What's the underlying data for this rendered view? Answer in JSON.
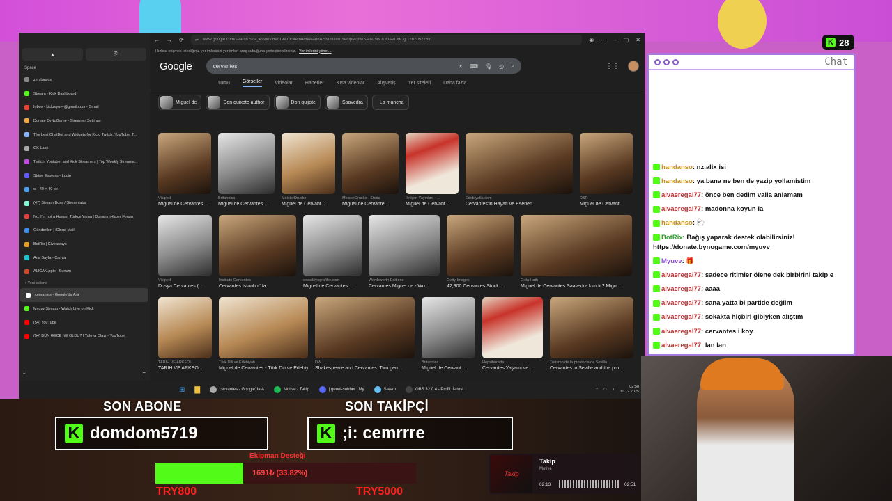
{
  "browser": {
    "url": "www.google.com/search?sca_esv=dc6ec19e7dc4ebae8easef=AE3TdOmrGAlupMqnwSAlNzsBUDOAVDHOg:1767052235",
    "info_text": "Hızlıca erişmek istediğiniz yer imlerinizi yer imleri araç çubuğuna yerleştirebilirsiniz.",
    "info_link": "Yer imlerini yönet...",
    "sidebar": {
      "space_label": "Space",
      "items": [
        {
          "label": "zen basics",
          "color": "#888"
        },
        {
          "label": "Stream - Kick Dashboard",
          "color": "#53fc18"
        },
        {
          "label": "Inbox - kickmyuvv@gmail.com - Gmail",
          "color": "#ea4335"
        },
        {
          "label": "Donate ByNoGame - Streamer Settings",
          "color": "#f4a742"
        },
        {
          "label": "The best ChatBot and Widgets for Kick, Twitch, YouTube, T...",
          "color": "#8ab4f8"
        },
        {
          "label": "GK Labs",
          "color": "#aaa"
        },
        {
          "label": "Twitch, Youtube, and Kick Streamers | Top Weekly Streame...",
          "color": "#c04ae0"
        },
        {
          "label": "Stripe Express - Login",
          "color": "#635bff"
        },
        {
          "label": "w - 40 × 40 px",
          "color": "#4aa0f0"
        },
        {
          "label": "(47) Stream Boss / Streamlabs",
          "color": "#80f5d2"
        },
        {
          "label": "No, I'm not a Human Türkçe Yama | DonanımHaber Forum",
          "color": "#e04040"
        },
        {
          "label": "Gönderilen | iCloud Mail",
          "color": "#3b8ef0"
        },
        {
          "label": "BotRix | Giveaways",
          "color": "#e8a020"
        },
        {
          "label": "Ana Sayfa - Canva",
          "color": "#20c4cc"
        },
        {
          "label": "ALICAN.pptx - Sunum",
          "color": "#d04a2a"
        }
      ],
      "new_tab": "Yeni sekme",
      "open_tabs": [
        {
          "label": "cervantes - Google'da Ara",
          "color": "#fff"
        },
        {
          "label": "Myuvv Stream - Watch Live on Kick",
          "color": "#53fc18"
        },
        {
          "label": "(54) YouTube",
          "color": "#ff0000"
        },
        {
          "label": "(54) DÜN GECE NE OLDU? | Yalova Olayı - YouTube",
          "color": "#ff0000"
        }
      ]
    },
    "google": {
      "logo": "Google",
      "query": "cervantes",
      "tabs": [
        "Tümü",
        "Görseller",
        "Videolar",
        "Haberler",
        "Kısa videolar",
        "Alışveriş",
        "Yer siteleri",
        "Daha fazla"
      ],
      "active_tab": "Görseller",
      "chips": [
        "Miguel de",
        "Don quixote author",
        "Don quijote",
        "Saavedra",
        "La mancha"
      ],
      "rows": [
        [
          {
            "src": "Vikipedi",
            "title": "Miguel de Cervantes ...",
            "w": 76,
            "tone": ""
          },
          {
            "src": "Britannica",
            "title": "Miguel de Cervantes ...",
            "w": 81,
            "tone": "bw"
          },
          {
            "src": "MeisterDrucke",
            "title": "Miguel de Cervant...",
            "w": 77,
            "tone": "lt"
          },
          {
            "src": "MeisterDrucke - Stoäa",
            "title": "Miguel de Cervante...",
            "w": 81,
            "tone": ""
          },
          {
            "src": "İletişim Yayınları · ...",
            "title": "Miguel de Cervant...",
            "w": 76,
            "tone": "rd"
          },
          {
            "src": "Edebiyatla.com",
            "title": "Cervantes'in Hayatı ve Eserleri",
            "w": 154,
            "tone": ""
          },
          {
            "src": "D&R",
            "title": "Miguel de Cervant...",
            "w": 76,
            "tone": ""
          }
        ],
        [
          {
            "src": "Vikipedi",
            "title": "Dosya:Cervantes (...",
            "w": 77,
            "tone": "bw"
          },
          {
            "src": "Instituto Cervantes",
            "title": "Cervantes İstanbul'da",
            "w": 111,
            "tone": ""
          },
          {
            "src": "www.biyografiler.com",
            "title": "Miguel de Cervantes ...",
            "w": 84,
            "tone": "bw"
          },
          {
            "src": "Wordsworth Editions",
            "title": "Cervantes Miguel de - Wo...",
            "w": 102,
            "tone": "bw"
          },
          {
            "src": "Getty Images",
            "title": "42,900 Cervantes Stock...",
            "w": 96,
            "tone": ""
          },
          {
            "src": "Gıda Hattı",
            "title": "Miguel de Cervantes Saavedra kimdir? Migu...",
            "w": 160,
            "tone": ""
          }
        ],
        [
          {
            "src": "TARİH VE ARKEOL...",
            "title": "TARİH VE ARKEO...",
            "w": 77,
            "tone": "lt"
          },
          {
            "src": "Türk Dili ve Edebiyatı",
            "title": "Miguel de Cervantes - Türk Dili ve Edebiyatı",
            "w": 128,
            "tone": "lt"
          },
          {
            "src": "DW",
            "title": "Shakespeare and Cervantes: Two gen...",
            "w": 143,
            "tone": ""
          },
          {
            "src": "Britannica",
            "title": "Miguel de Cervant...",
            "w": 77,
            "tone": "bw"
          },
          {
            "src": "Hepsiburada",
            "title": "Cervantes Yaşamı ve...",
            "w": 87,
            "tone": "rd"
          },
          {
            "src": "Turismo de la provincia de Sevilla",
            "title": "Cervantes in Seville and the pro...",
            "w": 120,
            "tone": ""
          }
        ]
      ]
    }
  },
  "taskbar": {
    "items": [
      {
        "label": "cervantes - Google'da A",
        "color": "#aaa"
      },
      {
        "label": "Motive - Takip",
        "color": "#1db954"
      },
      {
        "label": "| genel-sohbet | My",
        "color": "#5865f2"
      },
      {
        "label": "Steam",
        "color": "#66c0f4"
      },
      {
        "label": "OBS 32.0.4 - Profil: İsimsi",
        "color": "#444"
      }
    ],
    "time": "02:50",
    "date": "30.12.2025"
  },
  "chat": {
    "title": "Chat",
    "viewer_count": "28",
    "messages": [
      {
        "user": "handanso",
        "text": ": nz.alix isi",
        "cls": "orange"
      },
      {
        "user": "handanso",
        "text": ": ya bana ne ben de yazip yollamistim",
        "cls": "orange"
      },
      {
        "user": "alvaeregal77",
        "text": ": önce ben dedim valla anlamam",
        "cls": ""
      },
      {
        "user": "alvaeregal77",
        "text": ": madonna koyun la",
        "cls": ""
      },
      {
        "user": "handanso",
        "text": ": 🐑",
        "cls": "orange"
      },
      {
        "user": "BotRix",
        "text": ": Bağış yaparak destek olabilirsiniz! https://donate.bynogame.com/myuvv",
        "cls": "green",
        "wrap": true
      },
      {
        "user": "Myuvv",
        "text": ": 🎁",
        "cls": "purple"
      },
      {
        "user": "alvaeregal77",
        "text": ": sadece ritimler ölene dek birbirini takip e",
        "cls": ""
      },
      {
        "user": "alvaeregal77",
        "text": ": aaaa",
        "cls": ""
      },
      {
        "user": "alvaeregal77",
        "text": ": sana yatta bi partide değilm",
        "cls": ""
      },
      {
        "user": "alvaeregal77",
        "text": ": sokakta hiçbiri gibiyken alıştım",
        "cls": ""
      },
      {
        "user": "alvaeregal77",
        "text": ": cervantes i koy",
        "cls": ""
      },
      {
        "user": "alvaeregal77",
        "text": ": lan lan",
        "cls": ""
      }
    ]
  },
  "overlay": {
    "last_sub_label": "SON ABONE",
    "last_sub_name": "domdom5719",
    "last_follow_label": "SON TAKİPÇİ",
    "last_follow_name": ";i: cemrrre",
    "goal_title": "Ekipman Desteği",
    "goal_amount": "1691₺ (33.82%)",
    "goal_fraction": 0.3382,
    "goal_start": "TRY800",
    "goal_target": "TRY5000"
  },
  "music": {
    "title": "Takip",
    "artist": "Motive",
    "elapsed": "02:13",
    "duration": "02:51"
  }
}
